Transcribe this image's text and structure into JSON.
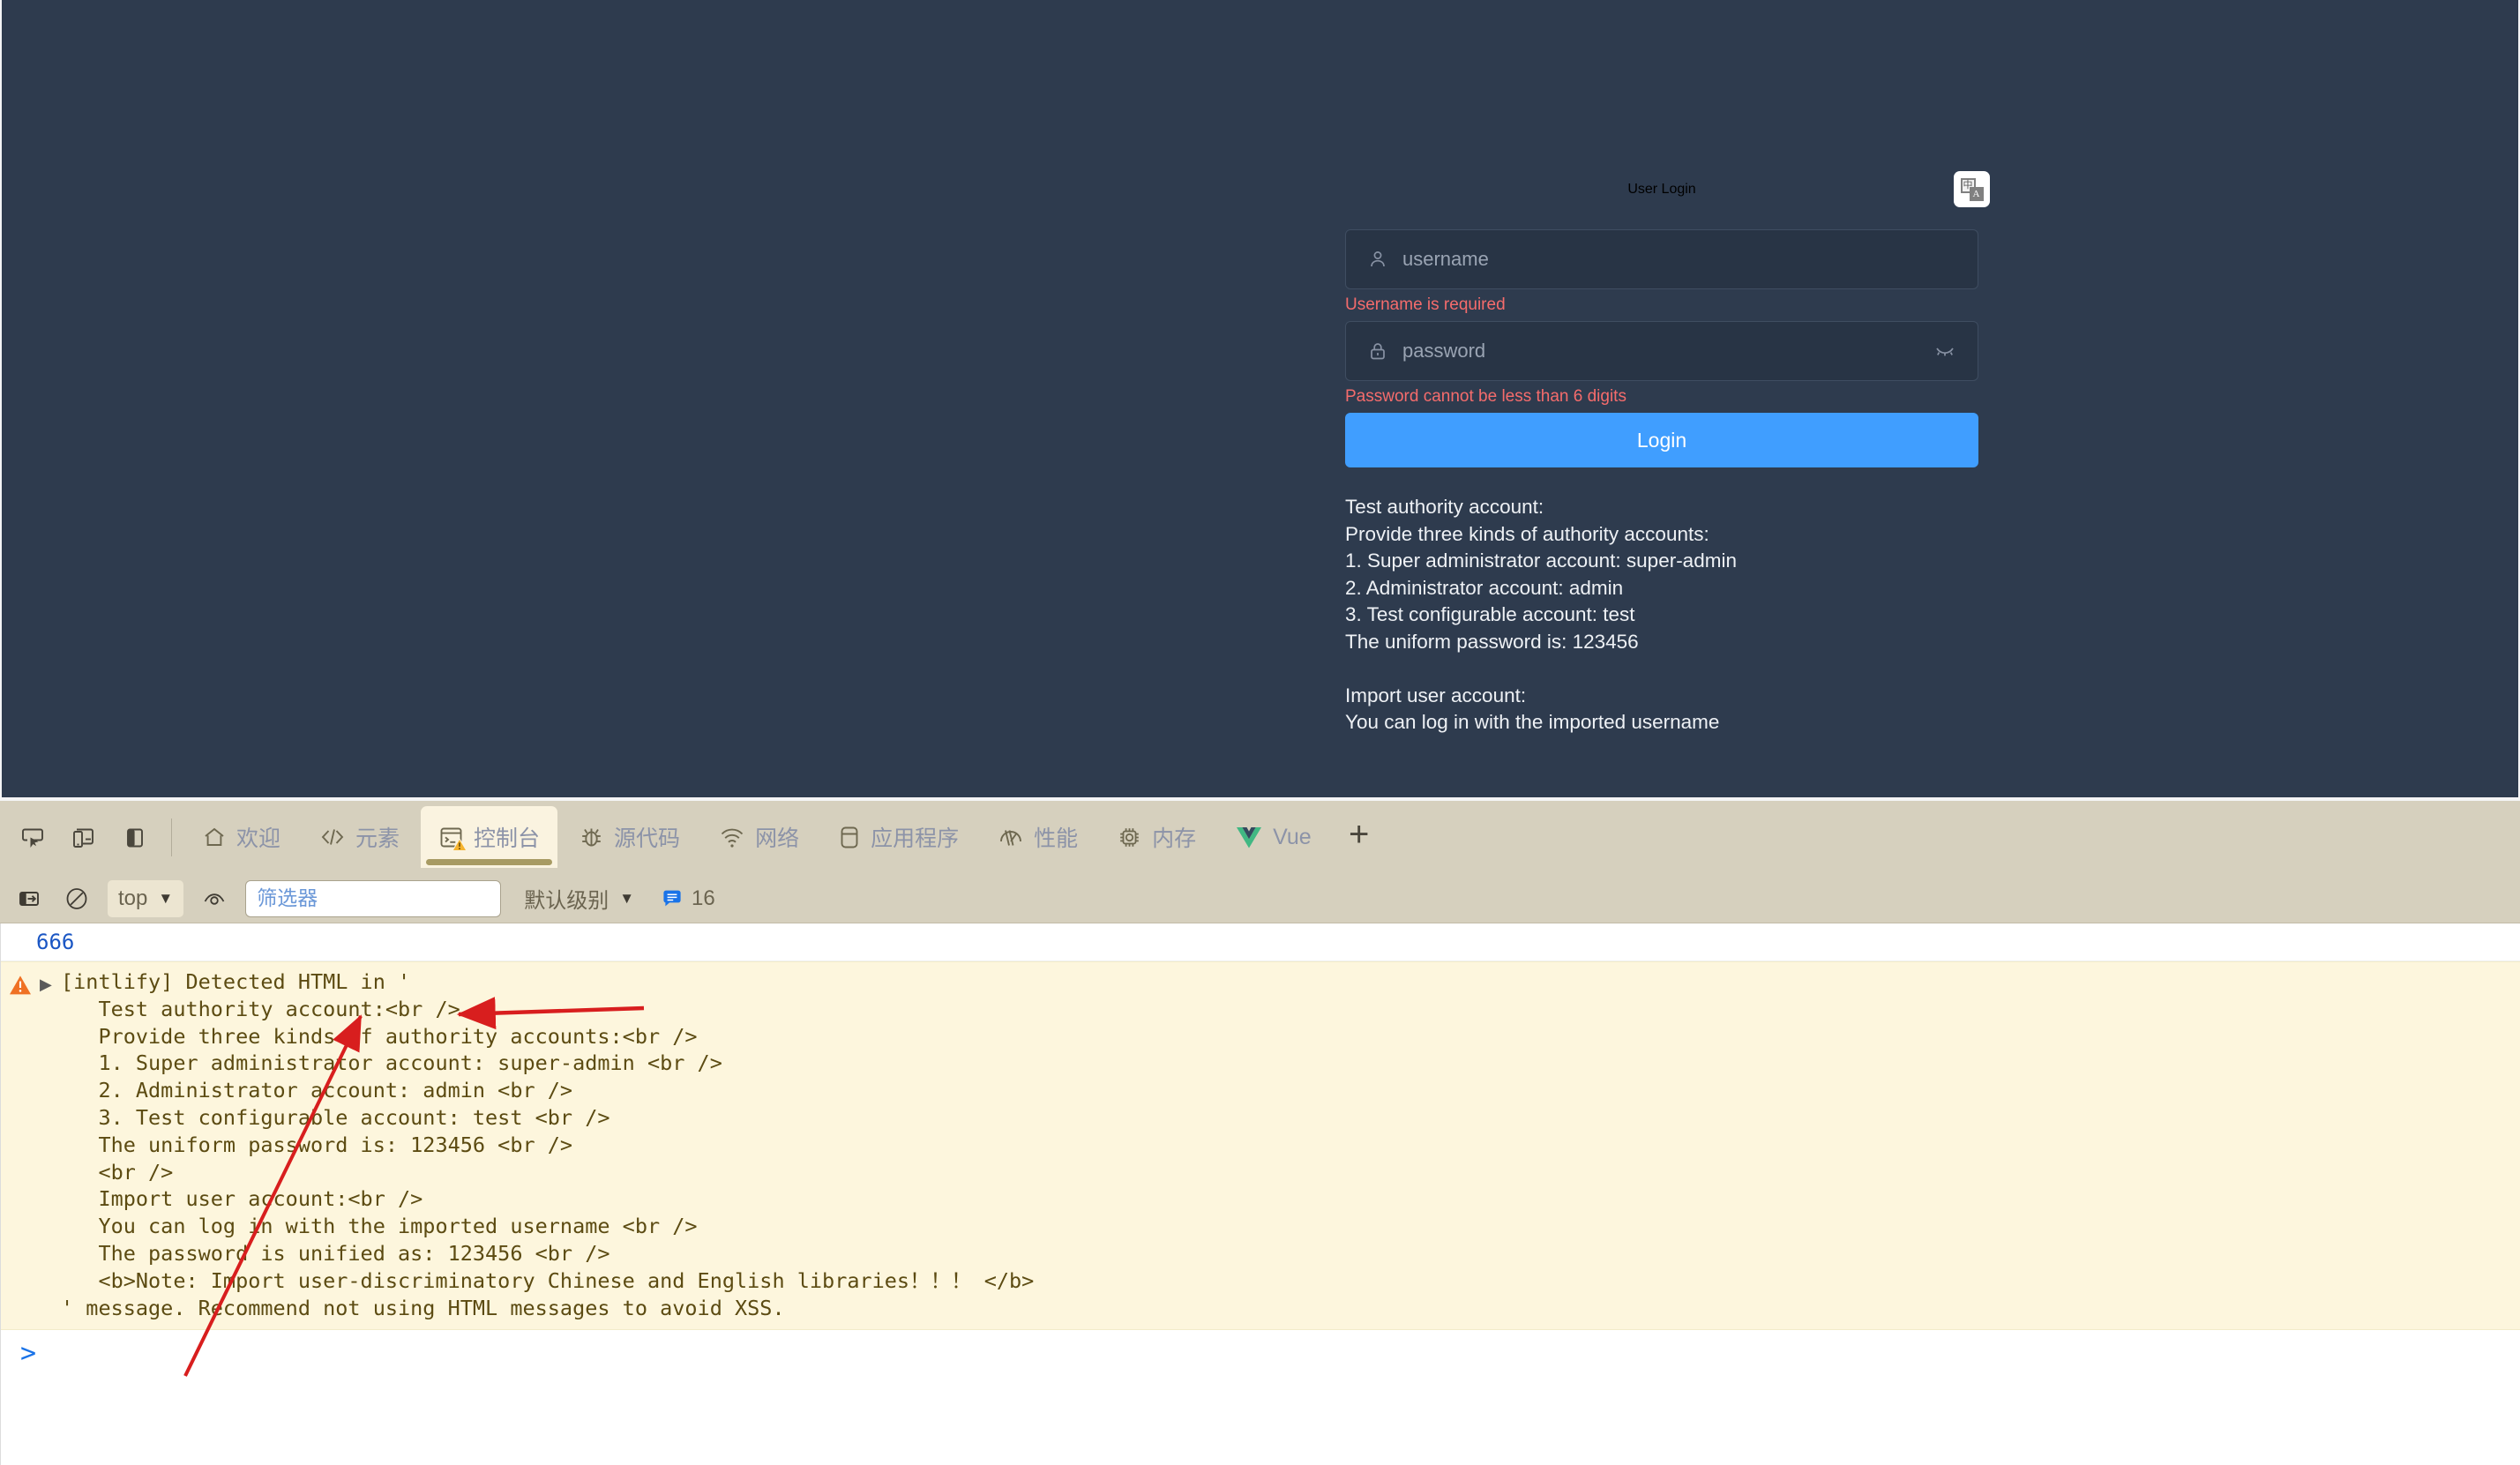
{
  "app": {
    "background_color": "#2e3b4e",
    "accent_color": "#409eff",
    "error_color": "#f56c6c"
  },
  "login": {
    "title": "User Login",
    "lang_toggle": {
      "icon": "translate-icon",
      "primary_glyph": "中",
      "secondary_glyph": "A"
    },
    "username": {
      "icon": "user-icon",
      "placeholder": "username",
      "value": "",
      "error": "Username is required"
    },
    "password": {
      "icon": "lock-icon",
      "placeholder": "password",
      "value": "",
      "error": "Password cannot be less than 6 digits",
      "reveal_icon": "eye-closed-icon"
    },
    "submit_label": "Login",
    "help_text": "Test authority account:\nProvide three kinds of authority accounts:\n1. Super administrator account: super-admin\n2. Administrator account: admin\n3. Test configurable account: test\nThe uniform password is: 123456\n\nImport user account:\nYou can log in with the imported username"
  },
  "devtools": {
    "left_icons": [
      {
        "name": "inspect-element-icon",
        "label": ""
      },
      {
        "name": "device-toolbar-icon",
        "label": ""
      },
      {
        "name": "dock-side-panel-icon",
        "label": ""
      }
    ],
    "tabs": [
      {
        "label": "欢迎",
        "icon": "home-icon",
        "active": false
      },
      {
        "label": "元素",
        "icon": "code-brackets-icon",
        "active": false
      },
      {
        "label": "控制台",
        "icon": "console-terminal-icon",
        "active": true,
        "badge": "warning-badge"
      },
      {
        "label": "源代码",
        "icon": "bug-icon",
        "active": false
      },
      {
        "label": "网络",
        "icon": "wifi-icon",
        "active": false
      },
      {
        "label": "应用程序",
        "icon": "database-icon",
        "active": false
      },
      {
        "label": "性能",
        "icon": "gauge-icon",
        "active": false
      },
      {
        "label": "内存",
        "icon": "chip-icon",
        "active": false
      },
      {
        "label": "Vue",
        "icon": "vue-logo-icon",
        "active": false
      }
    ],
    "add_tab_label": "+",
    "filterbar": {
      "clear_console_icon": "clear-console-icon",
      "no_entry_icon": "no-entry-icon",
      "context_selector": {
        "value": "top",
        "caret": "▼"
      },
      "eye_icon": "live-expression-eye-icon",
      "filter_placeholder": "筛选器",
      "filter_value": "",
      "level_selector": {
        "value": "默认级别",
        "caret": "▼"
      },
      "message_count": "16",
      "message_count_icon": "message-bubble-icon"
    },
    "console": {
      "rows": [
        {
          "type": "log",
          "text": "666"
        },
        {
          "type": "warning",
          "icon": "warning-triangle-icon",
          "expander": "▶",
          "text": "[intlify] Detected HTML in '\n   Test authority account:<br />\n   Provide three kinds of authority accounts:<br />\n   1. Super administrator account: super-admin <br />\n   2. Administrator account: admin <br />\n   3. Test configurable account: test <br />\n   The uniform password is: 123456 <br />\n   <br />\n   Import user account:<br />\n   You can log in with the imported username <br />\n   The password is unified as: 123456 <br />\n   <b>Note: Import user-discriminatory Chinese and English libraries！！！ </b>\n' message. Recommend not using HTML messages to avoid XSS."
        }
      ],
      "prompt": {
        "chevron": ">",
        "value": ""
      }
    }
  },
  "annotations": {
    "arrow_color": "#d81e1e",
    "arrows": [
      {
        "name": "arrow-to-html-in-quote",
        "note": ""
      },
      {
        "name": "arrow-to-message-body",
        "note": ""
      }
    ]
  }
}
